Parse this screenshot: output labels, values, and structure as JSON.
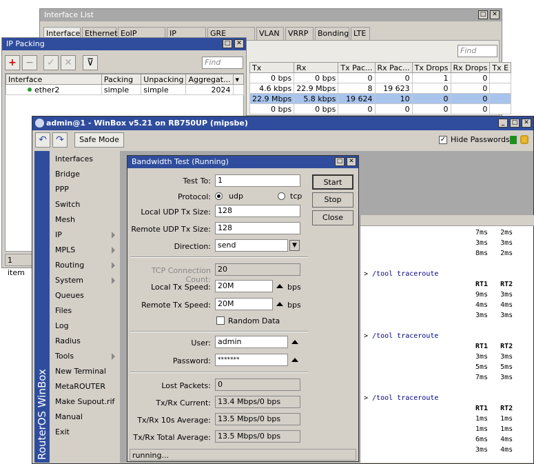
{
  "interface_list": {
    "title": "Interface List",
    "tabs": [
      "Interface",
      "Ethernet",
      "EoIP Tunnel",
      "IP Tunnel",
      "GRE Tunnel",
      "VLAN",
      "VRRP",
      "Bonding",
      "LTE"
    ],
    "find_placeholder": "Find",
    "columns": [
      "Tx",
      "Rx",
      "Tx Pac...",
      "Rx Pac...",
      "Tx Drops",
      "Rx Drops",
      "Tx E"
    ],
    "rows": [
      [
        "0 bps",
        "0 bps",
        "0",
        "0",
        "1",
        "0"
      ],
      [
        "4.6 kbps",
        "22.9 Mbps",
        "8",
        "19 623",
        "0",
        "0"
      ],
      [
        "22.9 Mbps",
        "5.8 kbps",
        "19 624",
        "10",
        "0",
        "0"
      ],
      [
        "0 bps",
        "0 bps",
        "0",
        "0",
        "0",
        "0"
      ]
    ]
  },
  "ip_packing": {
    "title": "IP Packing",
    "find_placeholder": "Find",
    "columns": [
      "Interface",
      "Packing",
      "Unpacking",
      "Aggregat..."
    ],
    "rows": [
      [
        "ether2",
        "simple",
        "simple",
        "2024"
      ]
    ],
    "status": "1 item"
  },
  "winbox": {
    "title": "admin@1 - WinBox v5.21 on RB750UP (mipsbe)",
    "safe_mode": "Safe Mode",
    "hide_passwords": "Hide Passwords",
    "side_label": "RouterOS WinBox",
    "menu": [
      {
        "label": "Interfaces",
        "sub": false
      },
      {
        "label": "Bridge",
        "sub": false
      },
      {
        "label": "PPP",
        "sub": false
      },
      {
        "label": "Switch",
        "sub": false
      },
      {
        "label": "Mesh",
        "sub": false
      },
      {
        "label": "IP",
        "sub": true
      },
      {
        "label": "MPLS",
        "sub": true
      },
      {
        "label": "Routing",
        "sub": true
      },
      {
        "label": "System",
        "sub": true
      },
      {
        "label": "Queues",
        "sub": false
      },
      {
        "label": "Files",
        "sub": false
      },
      {
        "label": "Log",
        "sub": false
      },
      {
        "label": "Radius",
        "sub": false
      },
      {
        "label": "Tools",
        "sub": true
      },
      {
        "label": "New Terminal",
        "sub": false
      },
      {
        "label": "MetaROUTER",
        "sub": false
      },
      {
        "label": "Make Supout.rif",
        "sub": false
      },
      {
        "label": "Manual",
        "sub": false
      },
      {
        "label": "Exit",
        "sub": false
      }
    ]
  },
  "bandwidth_test": {
    "title": "Bandwidth Test (Running)",
    "test_to_label": "Test To:",
    "test_to_value": "1",
    "protocol_label": "Protocol:",
    "protocol_udp": "udp",
    "protocol_tcp": "tcp",
    "local_udp_label": "Local UDP Tx Size:",
    "local_udp_value": "128",
    "remote_udp_label": "Remote UDP Tx Size:",
    "remote_udp_value": "128",
    "direction_label": "Direction:",
    "direction_value": "send",
    "tcp_count_label": "TCP Connection Count:",
    "tcp_count_value": "20",
    "local_speed_label": "Local Tx Speed:",
    "local_speed_value": "20M",
    "remote_speed_label": "Remote Tx Speed:",
    "remote_speed_value": "20M",
    "bps": "bps",
    "random_data": "Random Data",
    "user_label": "User:",
    "user_value": "admin",
    "password_label": "Password:",
    "password_value": "*******",
    "lost_label": "Lost Packets:",
    "lost_value": "0",
    "current_label": "Tx/Rx Current:",
    "current_value": "13.4 Mbps/0 bps",
    "avg10_label": "Tx/Rx 10s Average:",
    "avg10_value": "13.5 Mbps/0 bps",
    "total_label": "Tx/Rx Total Average:",
    "total_value": "13.5 Mbps/0 bps",
    "start": "Start",
    "stop": "Stop",
    "close": "Close",
    "status": "running..."
  },
  "terminal": {
    "prompt": ">",
    "command": "/tool traceroute",
    "hdr1": "RT1",
    "hdr2": "RT2",
    "top_rows": [
      [
        "7ms",
        "2ms"
      ],
      [
        "3ms",
        "3ms"
      ],
      [
        "8ms",
        "2ms"
      ]
    ],
    "block1": [
      [
        "9ms",
        "3ms"
      ],
      [
        "4ms",
        "4ms"
      ],
      [
        "3ms",
        "3ms"
      ]
    ],
    "block2": [
      [
        "3ms",
        "3ms"
      ],
      [
        "5ms",
        "5ms"
      ],
      [
        "7ms",
        "3ms"
      ]
    ],
    "block3": [
      [
        "1ms",
        "1ms"
      ],
      [
        "1ms",
        "1ms"
      ],
      [
        "6ms",
        "4ms"
      ],
      [
        "3ms",
        "4ms"
      ]
    ]
  }
}
